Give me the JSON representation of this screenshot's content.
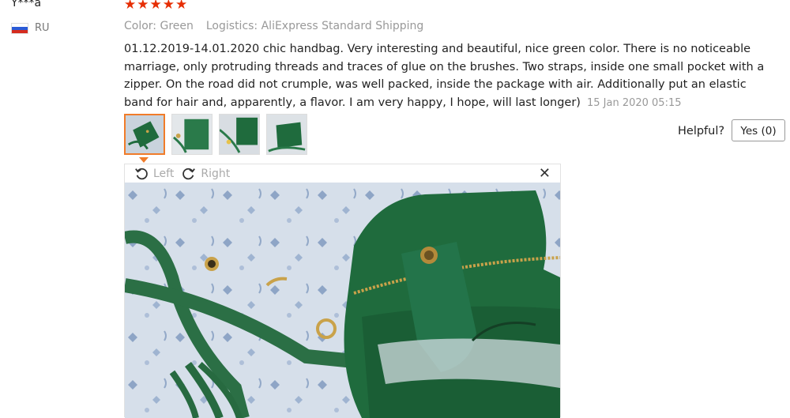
{
  "review": {
    "username": "Y***a",
    "country": "RU",
    "rating_stars": "★★★★★",
    "rating": 5,
    "color": "Color: Green",
    "logistics": "Logistics: AliExpress Standard Shipping",
    "text": "01.12.2019-14.01.2020 chic handbag. Very interesting and beautiful, nice green color. There is no noticeable marriage, only protruding threads and traces of glue on the brushes. Two straps, inside one small pocket with a zipper. On the road did not crumple, was well packed, inside the package with air. Additionally put an elastic band for hair and, apparently, a flavor. I am very happy, I hope, will last longer)",
    "date": "15 Jan 2020 05:15"
  },
  "thumbnails": [
    {
      "label": "",
      "active": true
    },
    {
      "label": "",
      "active": false
    },
    {
      "label": "",
      "active": false
    },
    {
      "label": "",
      "active": false
    }
  ],
  "helpful": {
    "label": "Helpful?",
    "yes_button": "Yes (0)"
  },
  "viewer": {
    "rotate_left": "Left",
    "rotate_right": "Right",
    "close_icon": "close-icon"
  },
  "colors": {
    "star": "#e62e04",
    "active_thumb": "#f07c2a",
    "bag_green": "#1f6b3d"
  }
}
